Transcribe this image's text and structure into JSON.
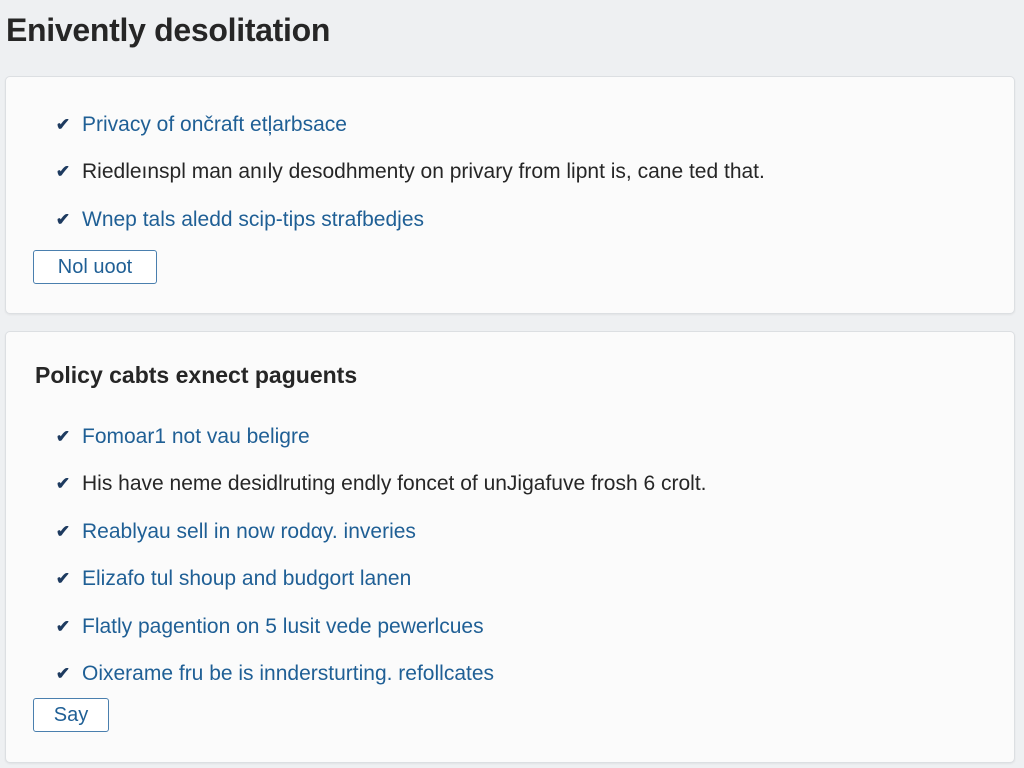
{
  "page": {
    "title": "Enivently desolitation"
  },
  "card_one": {
    "items": [
      {
        "text": "Privacy of ončraft etļarbsace",
        "style": "link"
      },
      {
        "text": "Riedleınspl man anıly desodhmenty on privary from lipnt is, cane ted that.",
        "style": "plain"
      },
      {
        "text": "Wnep tals aledd scip-tips strafbedjes",
        "style": "link"
      }
    ],
    "button_label": "Nol uoot"
  },
  "card_two": {
    "heading": "Policy cabts exnect paguents",
    "items": [
      {
        "text": "Fomoar1 not vau beligre",
        "style": "link"
      },
      {
        "text": "His have neme desidlruting endly foncet of unJigafuve frosh 6 crolt.",
        "style": "plain"
      },
      {
        "text": "Reablyau sell in now rodαy. inveries",
        "style": "link"
      },
      {
        "text": "Elizafo tul shoup and budgort lanen",
        "style": "link"
      },
      {
        "text": "Flatly pagention on 5 lusit vede pewerlcues",
        "style": "link"
      },
      {
        "text": "Oixerame fru be is inndersturting. refollcates",
        "style": "link"
      }
    ],
    "button_label": "Say"
  },
  "icons": {
    "check": "check-icon"
  },
  "colors": {
    "link_text": "#1f5f95",
    "body_text": "#262626",
    "check_mark": "#1d3a5f",
    "button_border": "#4a7fae",
    "background": "#eef0f2",
    "card": "#fbfbfb"
  }
}
